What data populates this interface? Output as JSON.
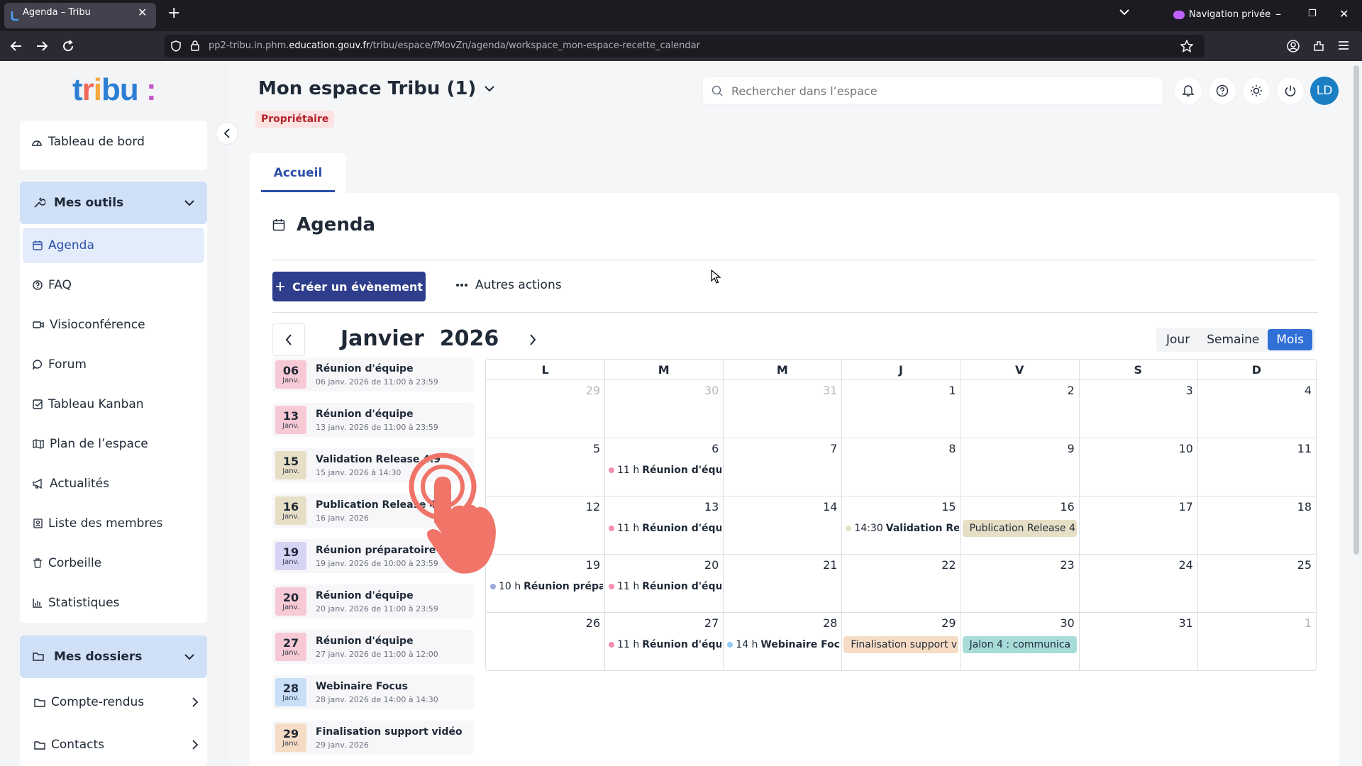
{
  "browser": {
    "tab_title": "Agenda – Tribu",
    "url_prefix": "pp2-tribu.in.phm.",
    "url_domain": "education.gouv.fr",
    "url_path": "/tribu/espace/fMovZn/agenda/workspace_mon-espace-recette_calendar",
    "private_label": "Navigation privée"
  },
  "sidebar": {
    "dashboard": "Tableau de bord",
    "tools_label": "Mes outils",
    "items": [
      "Agenda",
      "FAQ",
      "Visioconférence",
      "Forum",
      "Tableau Kanban",
      "Plan de l’espace",
      "Actualités",
      "Liste des membres",
      "Corbeille",
      "Statistiques"
    ],
    "folders_label": "Mes dossiers",
    "folders": [
      "Compte-rendus",
      "Contacts"
    ]
  },
  "header": {
    "space_title": "Mon espace Tribu (1)",
    "role_badge": "Propriétaire",
    "search_placeholder": "Rechercher dans l’espace",
    "avatar_initials": "LD"
  },
  "tabs": {
    "home": "Accueil"
  },
  "agenda": {
    "title": "Agenda",
    "create_label": "Créer un évènement",
    "more_label": "Autres actions",
    "month": "Janvier",
    "year": "2026",
    "views": [
      "Jour",
      "Semaine",
      "Mois"
    ],
    "selected_view": "Mois"
  },
  "events_list": [
    {
      "day": "06",
      "month": "Janv.",
      "title": "Réunion d'équipe",
      "sub": "06 janv. 2026 de 11:00 à 23:59",
      "color": "#f7c9d4"
    },
    {
      "day": "13",
      "month": "Janv.",
      "title": "Réunion d'équipe",
      "sub": "13 janv. 2026 de 11:00 à 23:59",
      "color": "#f7c9d4"
    },
    {
      "day": "15",
      "month": "Janv.",
      "title": "Validation Release 4.9",
      "sub": "15 janv. 2026 à 14:30",
      "color": "#e6dfc6"
    },
    {
      "day": "16",
      "month": "Janv.",
      "title": "Publication Release 4.9",
      "sub": "16 janv. 2026",
      "color": "#e6dfc6"
    },
    {
      "day": "19",
      "month": "Janv.",
      "title": "Réunion préparatoire",
      "sub": "19 janv. 2026 de 10:00 à 23:59",
      "color": "#d7d3f5"
    },
    {
      "day": "20",
      "month": "Janv.",
      "title": "Réunion d'équipe",
      "sub": "20 janv. 2026 de 11:00 à 23:59",
      "color": "#f7c9d4"
    },
    {
      "day": "27",
      "month": "Janv.",
      "title": "Réunion d'équipe",
      "sub": "27 janv. 2026 de 11:00 à 12:00",
      "color": "#f7c9d4"
    },
    {
      "day": "28",
      "month": "Janv.",
      "title": "Webinaire Focus",
      "sub": "28 janv. 2026 de 14:00 à 14:30",
      "color": "#c9def7"
    },
    {
      "day": "29",
      "month": "Janv.",
      "title": "Finalisation support vidéo",
      "sub": "29 janv. 2026",
      "color": "#f6dcc4"
    }
  ],
  "calendar": {
    "weekdays": [
      "L",
      "M",
      "M",
      "J",
      "V",
      "S",
      "D"
    ],
    "weeks": [
      [
        {
          "n": "29",
          "m": true
        },
        {
          "n": "30",
          "m": true
        },
        {
          "n": "31",
          "m": true
        },
        {
          "n": "1"
        },
        {
          "n": "2"
        },
        {
          "n": "3"
        },
        {
          "n": "4"
        }
      ],
      [
        {
          "n": "5"
        },
        {
          "n": "6"
        },
        {
          "n": "7"
        },
        {
          "n": "8"
        },
        {
          "n": "9"
        },
        {
          "n": "10"
        },
        {
          "n": "11"
        }
      ],
      [
        {
          "n": "12"
        },
        {
          "n": "13"
        },
        {
          "n": "14"
        },
        {
          "n": "15"
        },
        {
          "n": "16"
        },
        {
          "n": "17"
        },
        {
          "n": "18"
        }
      ],
      [
        {
          "n": "19"
        },
        {
          "n": "20"
        },
        {
          "n": "21"
        },
        {
          "n": "22"
        },
        {
          "n": "23"
        },
        {
          "n": "24"
        },
        {
          "n": "25"
        }
      ],
      [
        {
          "n": "26"
        },
        {
          "n": "27"
        },
        {
          "n": "28"
        },
        {
          "n": "29"
        },
        {
          "n": "30"
        },
        {
          "n": "31"
        },
        {
          "n": "1",
          "m": true
        }
      ]
    ],
    "events": [
      {
        "week": 1,
        "col": 1,
        "time": "11 h",
        "title": "Réunion d'équipe",
        "dot": "#f48fb1"
      },
      {
        "week": 2,
        "col": 1,
        "time": "11 h",
        "title": "Réunion d'équipe",
        "dot": "#f48fb1"
      },
      {
        "week": 2,
        "col": 3,
        "time": "14:30",
        "title": "Validation Relea",
        "dot": "#e6dfc6"
      },
      {
        "week": 3,
        "col": 0,
        "time": "10 h",
        "title": "Réunion prépara",
        "dot": "#9fa8da"
      },
      {
        "week": 3,
        "col": 1,
        "time": "11 h",
        "title": "Réunion d'équipe",
        "dot": "#f48fb1"
      },
      {
        "week": 4,
        "col": 1,
        "time": "11 h",
        "title": "Réunion d'équipe",
        "dot": "#f48fb1"
      },
      {
        "week": 4,
        "col": 2,
        "time": "14 h",
        "title": "Webinaire Focus",
        "dot": "#90caf9"
      }
    ],
    "allday": [
      {
        "week": 2,
        "col": 4,
        "title": "Publication Release 4",
        "color": "#e6dfc6"
      },
      {
        "week": 4,
        "col": 3,
        "title": "Finalisation support v",
        "color": "#f6dcc4"
      },
      {
        "week": 4,
        "col": 4,
        "title": "Jalon 4 : communica",
        "color": "#a8dcd9"
      }
    ]
  }
}
